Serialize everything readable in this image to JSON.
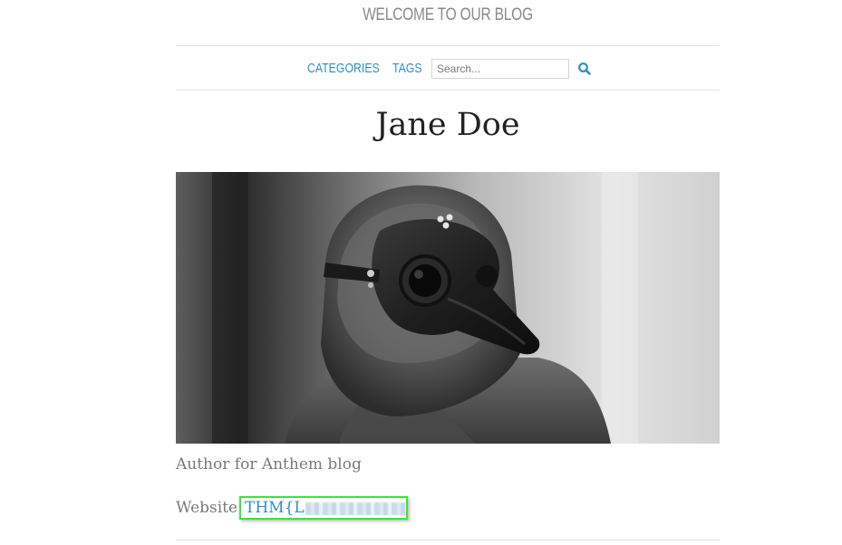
{
  "header": {
    "blog_title": "WELCOME TO OUR BLOG"
  },
  "nav": {
    "categories_label": "CATEGORIES",
    "tags_label": "TAGS",
    "search_placeholder": "Search...",
    "search_icon": "magnifier-icon"
  },
  "author": {
    "name": "Jane Doe",
    "photo_description_icon": "author-photo",
    "bio": "Author for Anthem blog",
    "website_label": "Website:",
    "website_value": "THM{L"
  },
  "colors": {
    "link": "#2f8fc9",
    "highlight_border": "#3ce33c",
    "muted_text": "#7a7a7a",
    "title_text": "#8a8a8a"
  }
}
